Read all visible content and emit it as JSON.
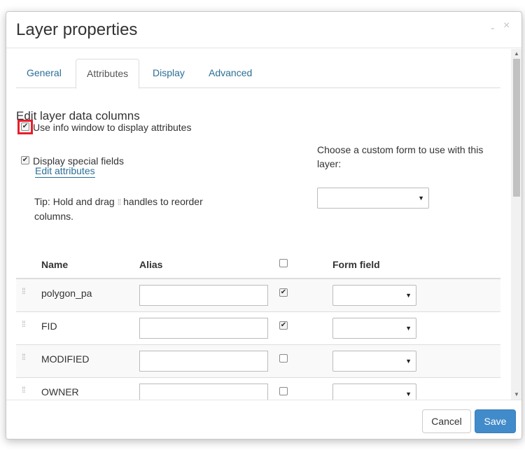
{
  "dialog": {
    "title": "Layer properties",
    "minimize_glyph": "-",
    "close_glyph": "×"
  },
  "tabs": [
    {
      "label": "General",
      "active": false
    },
    {
      "label": "Attributes",
      "active": true
    },
    {
      "label": "Display",
      "active": false
    },
    {
      "label": "Advanced",
      "active": false
    }
  ],
  "attributes": {
    "section_title": "Edit layer data columns",
    "use_info_window_label": "Use info window to display attributes",
    "use_info_window_checked": true,
    "display_special_fields_label": "Display special fields",
    "display_special_fields_checked": true,
    "edit_attributes_link": "Edit attributes",
    "tip_before": "Tip: Hold and drag",
    "tip_after": "handles to reorder columns.",
    "custom_form_label": "Choose a custom form to use with this layer:",
    "custom_form_value": ""
  },
  "table": {
    "columns": [
      "Name",
      "Alias",
      "",
      "Form field"
    ],
    "rows": [
      {
        "name": "polygon_pa",
        "alias": "",
        "visible": true,
        "form_field": ""
      },
      {
        "name": "FID",
        "alias": "",
        "visible": true,
        "form_field": ""
      },
      {
        "name": "MODIFIED",
        "alias": "",
        "visible": false,
        "form_field": ""
      },
      {
        "name": "OWNER",
        "alias": "",
        "visible": false,
        "form_field": ""
      }
    ]
  },
  "footer": {
    "cancel_label": "Cancel",
    "save_label": "Save"
  },
  "colors": {
    "link": "#2a6f96",
    "primary_button": "#428bca",
    "highlight": "#e81e2a"
  }
}
